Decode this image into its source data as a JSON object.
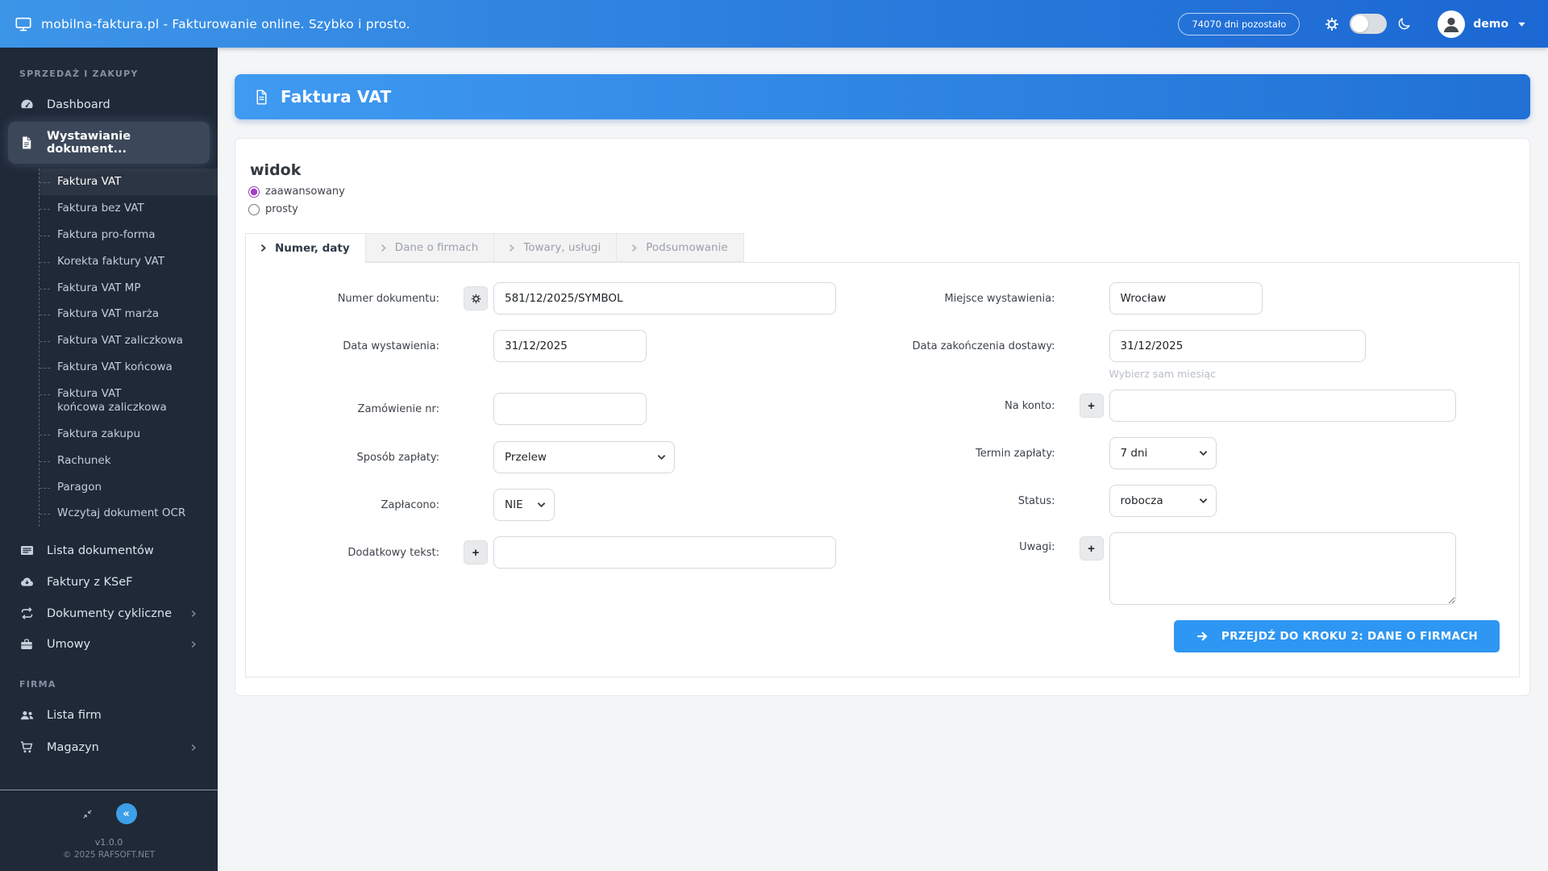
{
  "topbar": {
    "title": "mobilna-faktura.pl - Fakturowanie online. Szybko i prosto.",
    "days_badge": "74070 dni pozostało",
    "user": "demo"
  },
  "colors": {
    "topbar_gradient_start": "#3d95e8",
    "topbar_gradient_end": "#1b67d3",
    "sidebar_bg": "#1f2938",
    "accent_blue": "#2e96f3",
    "radio_accent": "#a23fc2"
  },
  "sidebar": {
    "section_sales": "SPRZEDAŻ I ZAKUPY",
    "dashboard": "Dashboard",
    "active_parent": "Wystawianie dokument...",
    "doc_types": [
      "Faktura VAT",
      "Faktura bez VAT",
      "Faktura pro-forma",
      "Korekta faktury VAT",
      "Faktura VAT MP",
      "Faktura VAT marża",
      "Faktura VAT zaliczkowa",
      "Faktura VAT końcowa",
      "Faktura VAT końcowa zaliczkowa",
      "Faktura zakupu",
      "Rachunek",
      "Paragon",
      "Wczytaj dokument OCR"
    ],
    "lista_dokumentow": "Lista dokumentów",
    "faktury_ksef": "Faktury z KSeF",
    "dokumenty_cykliczne": "Dokumenty cykliczne",
    "umowy": "Umowy",
    "section_firm": "FIRMA",
    "lista_firm": "Lista firm",
    "magazyn": "Magazyn",
    "version": "v1.0.0",
    "copyright": "© 2025 RAFSOFT.NET"
  },
  "banner": {
    "title": "Faktura VAT"
  },
  "view_switch": {
    "heading": "widok",
    "advanced": "zaawansowany",
    "simple": "prosty"
  },
  "tabs": [
    {
      "label": "Numer, daty",
      "active": true
    },
    {
      "label": "Dane o firmach",
      "active": false
    },
    {
      "label": "Towary, usługi",
      "active": false
    },
    {
      "label": "Podsumowanie",
      "active": false
    }
  ],
  "form": {
    "numer_dokumentu": {
      "label": "Numer dokumentu:",
      "value": "581/12/2025/SYMBOL"
    },
    "data_wystawienia": {
      "label": "Data wystawienia:",
      "value": "31/12/2025"
    },
    "zamowienie_nr": {
      "label": "Zamówienie nr:",
      "value": ""
    },
    "sposob_zaplaty": {
      "label": "Sposób zapłaty:",
      "value": "Przelew"
    },
    "zaplacono": {
      "label": "Zapłacono:",
      "value": "NIE"
    },
    "dodatkowy_tekst": {
      "label": "Dodatkowy tekst:",
      "value": ""
    },
    "miejsce_wystawienia": {
      "label": "Miejsce wystawienia:",
      "value": "Wrocław"
    },
    "data_zakonczenia": {
      "label": "Data zakończenia dostawy:",
      "value": "31/12/2025",
      "hint": "Wybierz sam miesiąc"
    },
    "na_konto": {
      "label": "Na konto:",
      "value": ""
    },
    "termin_zaplaty": {
      "label": "Termin zapłaty:",
      "value": "7 dni"
    },
    "status": {
      "label": "Status:",
      "value": "robocza"
    },
    "uwagi": {
      "label": "Uwagi:",
      "value": ""
    },
    "next_button": "PRZEJDŹ DO KROKU 2: DANE O FIRMACH"
  }
}
